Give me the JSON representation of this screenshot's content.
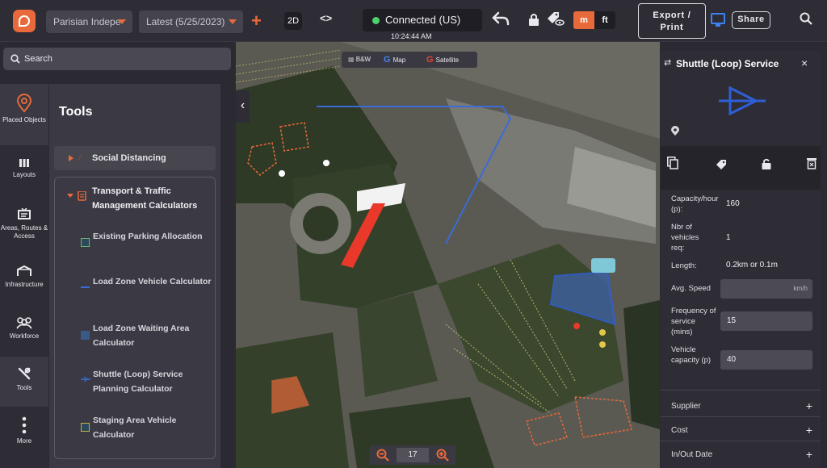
{
  "topbar": {
    "project_select": "Parisian Indepe",
    "version_select": "Latest (5/25/2023)",
    "view_mode": "2D",
    "connection_status": "Connected (US)",
    "clock": "10:24:44 AM",
    "unit_m": "m",
    "unit_ft": "ft",
    "export_label_line1": "Export /",
    "export_label_line2": "Print",
    "share_label": "Share",
    "accent": "#e8693a",
    "status_green": "#4cd26b"
  },
  "search": {
    "placeholder": "Search"
  },
  "nav": {
    "items": [
      {
        "label": "Placed Objects",
        "icon": "map-pin-icon"
      },
      {
        "label": "Layouts",
        "icon": "bars-icon"
      },
      {
        "label": "Areas, Routes & Access",
        "icon": "signboard-icon"
      },
      {
        "label": "Infrastructure",
        "icon": "tent-icon"
      },
      {
        "label": "Workforce",
        "icon": "people-icon"
      },
      {
        "label": "Tools",
        "icon": "wrench-icon"
      },
      {
        "label": "More",
        "icon": "more-vertical-icon"
      }
    ]
  },
  "tools": {
    "title": "Tools",
    "social_distancing": "Social Distancing",
    "group_title": "Transport & Traffic Management Calculators",
    "items": [
      {
        "label": "Existing Parking Allocation"
      },
      {
        "label": "Load Zone Vehicle Calculator"
      },
      {
        "label": "Load Zone Waiting Area Calculator"
      },
      {
        "label": "Shuttle (Loop) Service Planning Calculator"
      },
      {
        "label": "Staging Area Vehicle Calculator"
      }
    ]
  },
  "map": {
    "bw_label": "B&W",
    "map_label": "Map",
    "satellite_label": "Satellite",
    "zoom_level": "17"
  },
  "panel": {
    "title": "Shuttle (Loop) Service",
    "capacity_label": "Capacity/hour (p):",
    "capacity_value": "160",
    "vehicles_label": "Nbr of vehicles req:",
    "vehicles_value": "1",
    "length_label": "Length:",
    "length_value": "0.2km or 0.1m",
    "speed_label": "Avg. Speed",
    "speed_unit": "km/h",
    "frequency_label": "Frequency of service (mins)",
    "frequency_value": "15",
    "vehicle_capacity_label": "Vehicle capacity (p)",
    "vehicle_capacity_value": "40",
    "supplier_label": "Supplier",
    "cost_label": "Cost",
    "inout_label": "In/Out Date",
    "accent_blue": "#2f5fd6"
  }
}
